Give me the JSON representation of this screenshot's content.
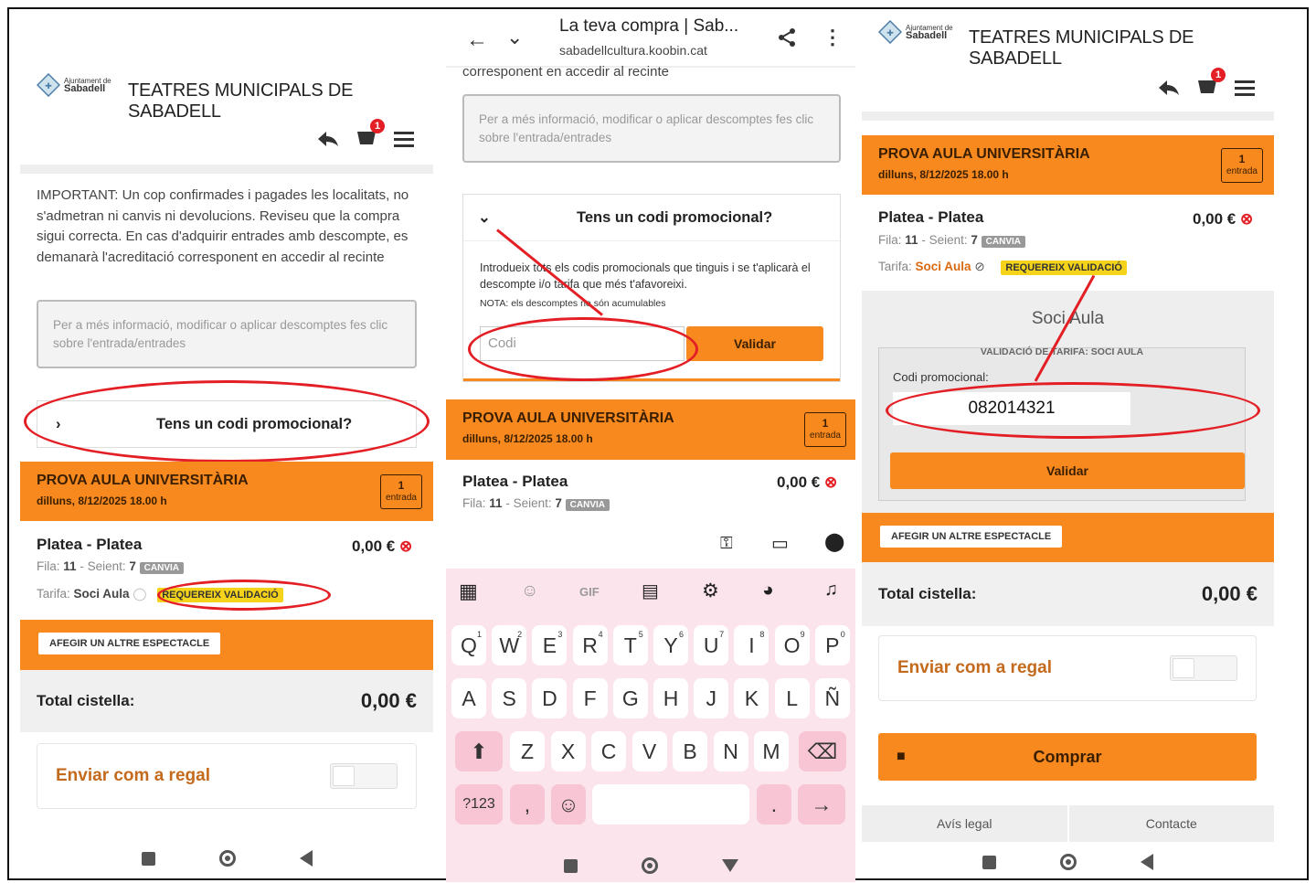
{
  "site": {
    "logo_line1": "Ajuntament de",
    "logo_line2": "Sabadell",
    "title": "TEATRES MUNICIPALS DE SABADELL",
    "cart_count": "1"
  },
  "note": "IMPORTANT: Un cop confirmades i pagades les localitats, no s'admetran ni canvis ni devolucions. Reviseu que la compra sigui correcta. En cas d'adquirir entrades amb descompte, es demanarà l'acreditació corresponent en accedir al recinte",
  "note_tail": "corresponent en accedir al recinte",
  "info_box": "Per a més informació, modificar o aplicar descomptes fes clic sobre l'entrada/entrades",
  "promo": {
    "question": "Tens un codi promocional?",
    "intro": "Introdueix tots els codis promocionals que tinguis i se t'aplicarà el descompte i/o tarifa que més t'afavoreixi.",
    "nota": "NOTA: els descomptes no són acumulables",
    "placeholder": "Codi",
    "validate": "Validar"
  },
  "event": {
    "title": "PROVA AULA UNIVERSITÀRIA",
    "date": "dilluns, 8/12/2025 18.00 h",
    "qty": "1",
    "qty_label": "entrada"
  },
  "seat": {
    "title": "Platea - Platea",
    "row_label": "Fila:",
    "row": "11",
    "seat_label": "- Seient:",
    "seat": "7",
    "change_tag": "CANVIA",
    "price": "0,00 €",
    "tariff_label": "Tarifa:",
    "tariff": "Soci Aula",
    "validation_tag": "REQUEREIX VALIDACIÓ"
  },
  "validation_panel": {
    "title": "Soci Aula",
    "legend": "VALIDACIÓ DE TARIFA: SOCI AULA",
    "field_label": "Codi promocional:",
    "field_value": "082014321",
    "validate": "Validar"
  },
  "add_show": "AFEGIR UN ALTRE ESPECTACLE",
  "total": {
    "label": "Total cistella:",
    "value": "0,00 €"
  },
  "gift": "Enviar com a regal",
  "buy": "Comprar",
  "footer": {
    "legal": "Avís legal",
    "contact": "Contacte"
  },
  "browser": {
    "title": "La teva compra | Sab...",
    "url": "sabadellcultura.koobin.cat"
  },
  "keyboard": {
    "row1": [
      "Q",
      "W",
      "E",
      "R",
      "T",
      "Y",
      "U",
      "I",
      "O",
      "P"
    ],
    "row1_sup": [
      "1",
      "2",
      "3",
      "4",
      "5",
      "6",
      "7",
      "8",
      "9",
      "0"
    ],
    "row2": [
      "A",
      "S",
      "D",
      "F",
      "G",
      "H",
      "J",
      "K",
      "L",
      "Ñ"
    ],
    "row3": [
      "Z",
      "X",
      "C",
      "V",
      "B",
      "N",
      "M"
    ],
    "sym": "?123",
    "comma": ",",
    "period": ".",
    "gif": "GIF"
  },
  "colors": {
    "orange": "#f7891f",
    "red": "#e31e24",
    "yellow": "#f6d31b"
  }
}
